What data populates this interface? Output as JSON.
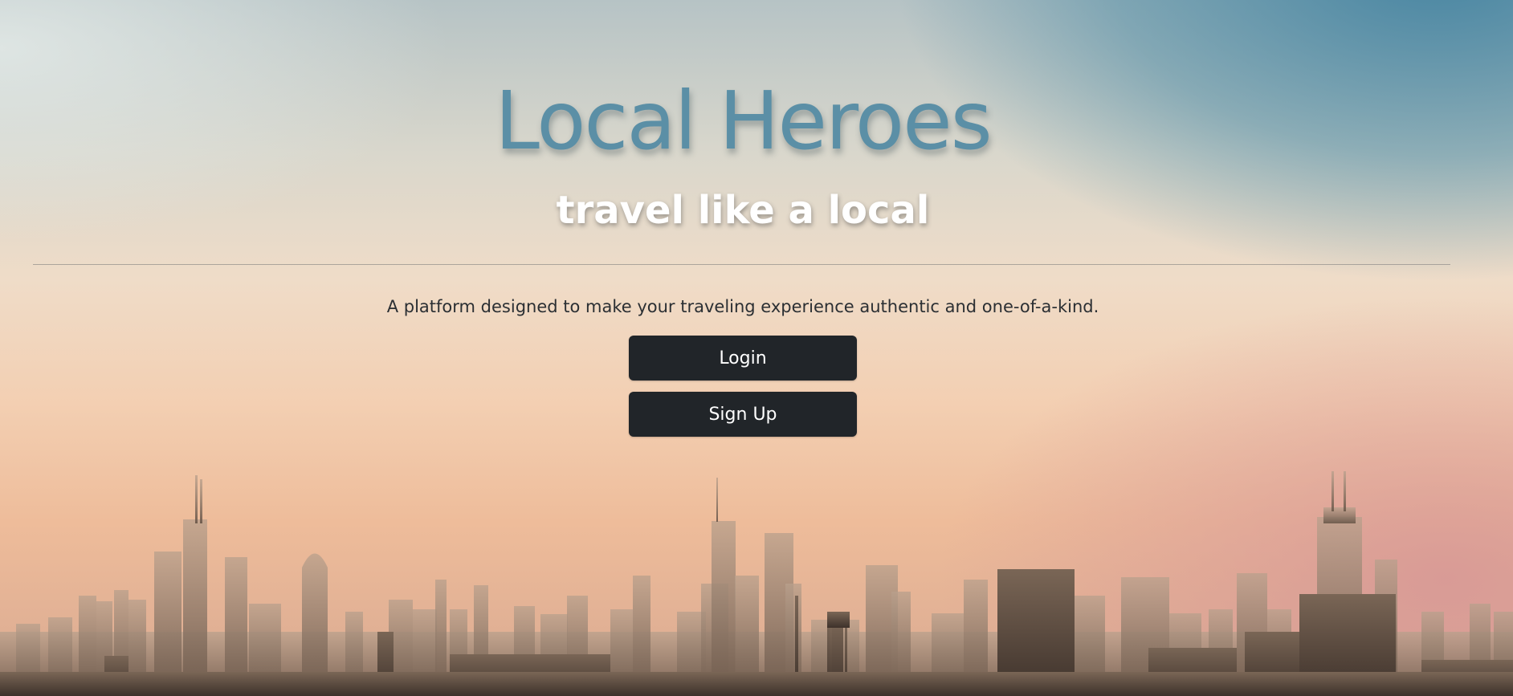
{
  "hero": {
    "title": "Local Heroes",
    "tagline": "travel like a local",
    "description": "A platform designed to make your traveling experience authentic and one-of-a-kind."
  },
  "actions": {
    "login_label": "Login",
    "signup_label": "Sign Up"
  },
  "colors": {
    "title": "#5b8fa6",
    "button_bg": "#212529",
    "button_text": "#ffffff"
  },
  "background": {
    "icon": "city-skyline-icon"
  }
}
